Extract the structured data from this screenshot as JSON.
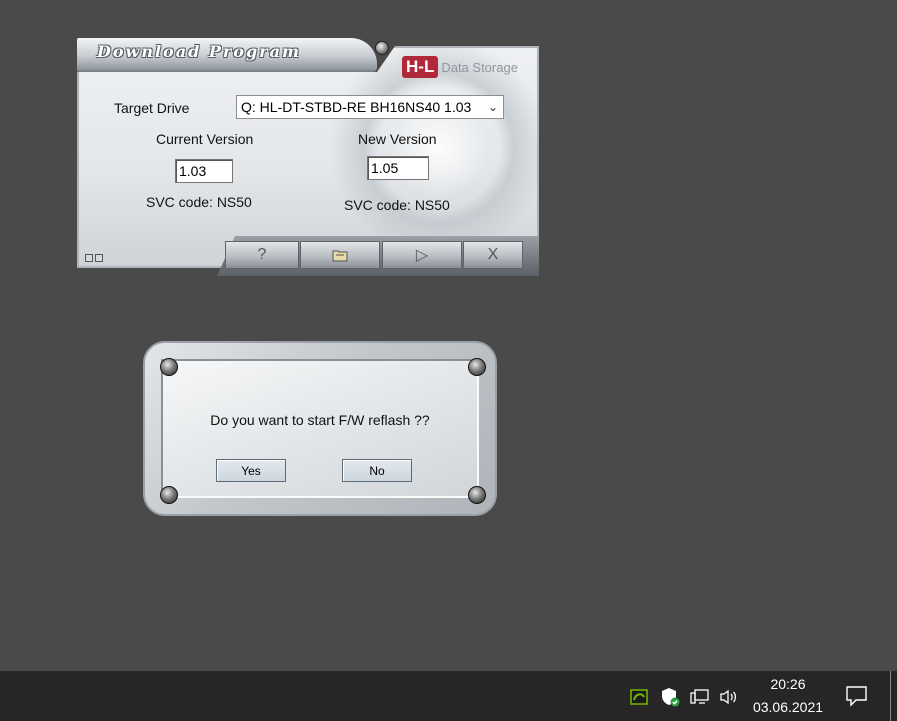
{
  "download_window": {
    "title": "Download Program",
    "logo_mark": "H-L",
    "logo_text": "Data Storage",
    "target_drive_label": "Target Drive",
    "target_drive_value": "Q: HL-DT-STBD-RE  BH16NS40 1.03",
    "current_version_label": "Current Version",
    "current_version_value": "1.03",
    "new_version_label": "New Version",
    "new_version_value": "1.05",
    "current_svc": "SVC code: NS50",
    "new_svc": "SVC code: NS50",
    "toolbar": [
      {
        "name": "help",
        "glyph": "?"
      },
      {
        "name": "open-file",
        "glyph": "folder"
      },
      {
        "name": "start",
        "glyph": "▷"
      },
      {
        "name": "exit",
        "glyph": "X"
      }
    ]
  },
  "confirm_dialog": {
    "message": "Do you want to start F/W reflash ??",
    "yes_label": "Yes",
    "no_label": "No"
  },
  "taskbar": {
    "time": "20:26",
    "date": "03.06.2021",
    "tray_icons": [
      "nvidia-icon",
      "security-shield-icon",
      "network-icon",
      "volume-icon"
    ],
    "action_center_icon": "notification-icon"
  },
  "colors": {
    "desktop_bg": "#4a4a4a",
    "taskbar_bg": "#262626",
    "logo_red": "#b0283a"
  }
}
